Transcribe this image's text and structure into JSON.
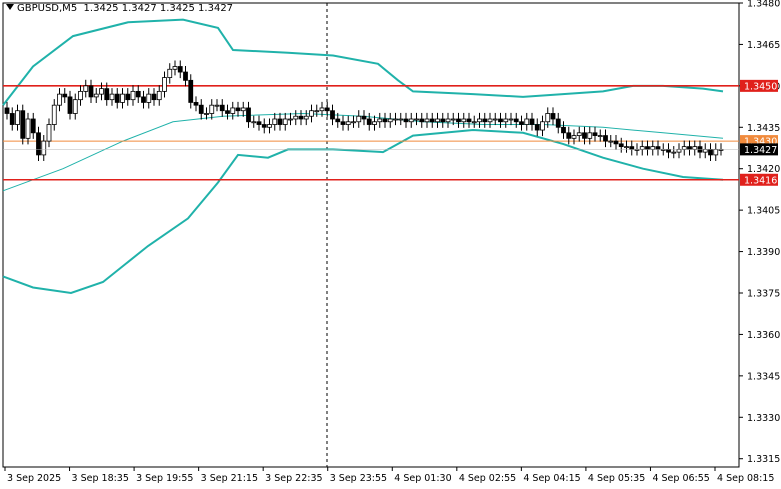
{
  "header": {
    "symbol": "GBPUSD,M5",
    "ohlc": "1.3425 1.3427 1.3425 1.3427"
  },
  "chart_data": {
    "type": "candlestick",
    "symbol": "GBPUSD",
    "timeframe": "M5",
    "grid": false,
    "ylim": [
      1.3312,
      1.348
    ],
    "y_ticks": [
      "1.3480",
      "1.3465",
      "1.3450",
      "1.3435",
      "1.3420",
      "1.3405",
      "1.3390",
      "1.3375",
      "1.3360",
      "1.3345",
      "1.3330",
      "1.3315"
    ],
    "x_ticks": [
      "3 Sep 2025",
      "3 Sep 18:35",
      "3 Sep 19:55",
      "3 Sep 21:15",
      "3 Sep 22:35",
      "3 Sep 23:55",
      "4 Sep 01:30",
      "4 Sep 02:55",
      "4 Sep 04:15",
      "4 Sep 05:35",
      "4 Sep 06:55",
      "4 Sep 08:15"
    ],
    "horizontal_levels": [
      {
        "value": 1.345,
        "label": "1.3450",
        "color": "#e0201b"
      },
      {
        "value": 1.343,
        "label": "1.3430",
        "color": "#f08a3c"
      },
      {
        "value": 1.3416,
        "label": "1.3416",
        "color": "#e0201b"
      }
    ],
    "current_price": {
      "value": 1.3427,
      "label": "1.3427"
    },
    "closes": [
      1.344,
      1.3436,
      1.3441,
      1.3431,
      1.3438,
      1.3433,
      1.3425,
      1.343,
      1.3436,
      1.3443,
      1.3447,
      1.3446,
      1.344,
      1.3445,
      1.3448,
      1.345,
      1.3446,
      1.3447,
      1.3449,
      1.3445,
      1.3447,
      1.3444,
      1.3447,
      1.3445,
      1.3448,
      1.3446,
      1.3444,
      1.3447,
      1.3445,
      1.3448,
      1.3453,
      1.3456,
      1.3457,
      1.3455,
      1.3452,
      1.3444,
      1.3443,
      1.344,
      1.344,
      1.3443,
      1.3443,
      1.3441,
      1.344,
      1.3442,
      1.3441,
      1.3442,
      1.3437,
      1.3437,
      1.3436,
      1.3435,
      1.3436,
      1.3438,
      1.3436,
      1.3438,
      1.3438,
      1.3439,
      1.3438,
      1.3439,
      1.3441,
      1.3441,
      1.3442,
      1.3441,
      1.3438,
      1.3437,
      1.3436,
      1.3437,
      1.3437,
      1.3439,
      1.3438,
      1.3436,
      1.3437,
      1.3438,
      1.3437,
      1.3438,
      1.3438,
      1.3438,
      1.3437,
      1.3438,
      1.3438,
      1.3437,
      1.3438,
      1.3437,
      1.3438,
      1.3437,
      1.3438,
      1.3438,
      1.3437,
      1.3438,
      1.3437,
      1.3437,
      1.3438,
      1.3437,
      1.3438,
      1.3438,
      1.3437,
      1.3438,
      1.3438,
      1.3437,
      1.3436,
      1.3438,
      1.3436,
      1.3434,
      1.3437,
      1.344,
      1.3438,
      1.3435,
      1.3433,
      1.3431,
      1.3432,
      1.3433,
      1.3431,
      1.3433,
      1.3432,
      1.3432,
      1.343,
      1.343,
      1.3429,
      1.3428,
      1.3428,
      1.3427,
      1.3427,
      1.3428,
      1.3427,
      1.3428,
      1.3427,
      1.3427,
      1.3426,
      1.3426,
      1.3427,
      1.3428,
      1.3427,
      1.3428,
      1.3426,
      1.3427,
      1.3425,
      1.3427,
      1.3427
    ],
    "bands": {
      "upper": [
        [
          0,
          1.3443
        ],
        [
          30,
          1.3457
        ],
        [
          70,
          1.3468
        ],
        [
          125,
          1.3473
        ],
        [
          180,
          1.3474
        ],
        [
          215,
          1.3471
        ],
        [
          230,
          1.3463
        ],
        [
          285,
          1.3462
        ],
        [
          330,
          1.3461
        ],
        [
          375,
          1.3458
        ],
        [
          395,
          1.3452
        ],
        [
          410,
          1.3448
        ],
        [
          470,
          1.3447
        ],
        [
          520,
          1.3446
        ],
        [
          560,
          1.3447
        ],
        [
          600,
          1.3448
        ],
        [
          630,
          1.345
        ],
        [
          660,
          1.345
        ],
        [
          700,
          1.3449
        ],
        [
          720,
          1.3448
        ]
      ],
      "middle": [
        [
          0,
          1.3412
        ],
        [
          60,
          1.342
        ],
        [
          120,
          1.343
        ],
        [
          170,
          1.3437
        ],
        [
          220,
          1.3439
        ],
        [
          300,
          1.344
        ],
        [
          360,
          1.3439
        ],
        [
          420,
          1.3437
        ],
        [
          480,
          1.3436
        ],
        [
          540,
          1.3436
        ],
        [
          600,
          1.3435
        ],
        [
          660,
          1.3433
        ],
        [
          720,
          1.3431
        ]
      ],
      "lower": [
        [
          0,
          1.3381
        ],
        [
          30,
          1.3377
        ],
        [
          68,
          1.3375
        ],
        [
          100,
          1.3379
        ],
        [
          145,
          1.3392
        ],
        [
          185,
          1.3402
        ],
        [
          215,
          1.3415
        ],
        [
          235,
          1.3425
        ],
        [
          265,
          1.3424
        ],
        [
          285,
          1.3427
        ],
        [
          330,
          1.3427
        ],
        [
          380,
          1.3426
        ],
        [
          410,
          1.3432
        ],
        [
          470,
          1.3434
        ],
        [
          520,
          1.3433
        ],
        [
          560,
          1.3429
        ],
        [
          600,
          1.3424
        ],
        [
          640,
          1.342
        ],
        [
          680,
          1.3417
        ],
        [
          720,
          1.3416
        ]
      ]
    },
    "band_color": "#20b2aa"
  }
}
